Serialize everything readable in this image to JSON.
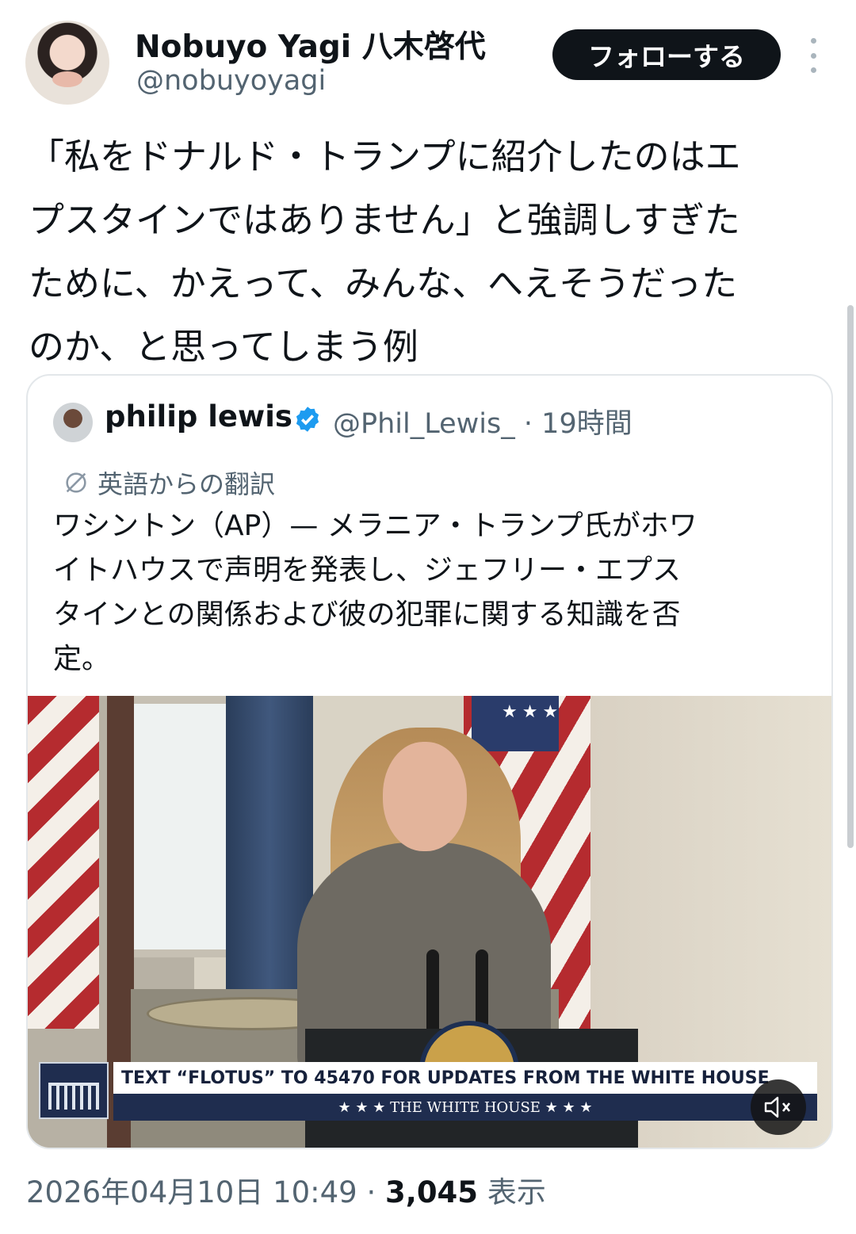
{
  "author": {
    "name": "Nobuyo Yagi 八木啓代",
    "handle": "@nobuyoyagi",
    "follow_label": "フォローする"
  },
  "tweet": {
    "text_lines": [
      "「私をドナルド・トランプに紹介したのはエ",
      "プスタインではありません」と強調しすぎた",
      "ために、かえって、みんな、へえそうだった",
      "のか、と思ってしまう例"
    ]
  },
  "quoted": {
    "name": "philip lewis",
    "handle": "@Phil_Lewis_",
    "time_sep": "·",
    "time": "19時間",
    "translate_label": "英語からの翻訳",
    "text_lines": [
      "ワシントン（AP）— メラニア・トランプ氏がホワ",
      "イトハウスで声明を発表し、ジェフリー・エプス",
      "タインとの関係および彼の犯罪に関する知識を否",
      "定。"
    ],
    "media": {
      "banner_text": "TEXT “FLOTUS” TO 45470 FOR UPDATES FROM THE WHITE HOUSE",
      "subbanner_text": "★ ★ ★   THE WHITE HOUSE   ★ ★ ★",
      "icons": [
        "white-house-logo-icon",
        "mute-icon"
      ]
    }
  },
  "meta": {
    "date": "2026年04月10日 10:49",
    "sep": "·",
    "views": "3,045",
    "views_label": "表示"
  },
  "colors": {
    "text": "#0f1419",
    "secondary": "#536471",
    "verified": "#1d9bf0",
    "border": "#e3e7ea",
    "follow_bg": "#0f1419"
  }
}
